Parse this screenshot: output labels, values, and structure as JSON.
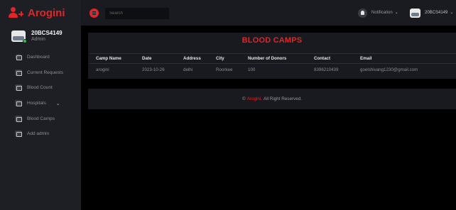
{
  "brand": {
    "name": "Arogini",
    "accent": "#e0252b"
  },
  "profile": {
    "id": "20BCS4149",
    "role": "Admin"
  },
  "sidebar": {
    "items": [
      {
        "label": "Dashboard",
        "icon": "dashboard-icon"
      },
      {
        "label": "Current Requests",
        "icon": "monitor-icon"
      },
      {
        "label": "Blood Count",
        "icon": "grid-icon"
      },
      {
        "label": "Hospitals",
        "icon": "hospital-icon",
        "chevron": "⌄"
      },
      {
        "label": "Blood Camps",
        "icon": "camp-icon"
      },
      {
        "label": "Add admin",
        "icon": "chart-icon"
      }
    ]
  },
  "topbar": {
    "search_placeholder": "Search",
    "notifications_label": "Notification",
    "user": "20BCS4149"
  },
  "main": {
    "title": "BLOOD CAMPS",
    "columns": [
      "Camp Name",
      "Date",
      "Address",
      "City",
      "Number of Donors",
      "Contact",
      "Email"
    ],
    "rows": [
      [
        "arogini",
        "2023-10-26",
        "delhi",
        "Roorkee",
        "100",
        "8396210439",
        "goelshivang1230@gmail.com"
      ]
    ]
  },
  "footer": {
    "copyright": "©",
    "brand": "Arogini.",
    "text": "All Right Reserved."
  }
}
